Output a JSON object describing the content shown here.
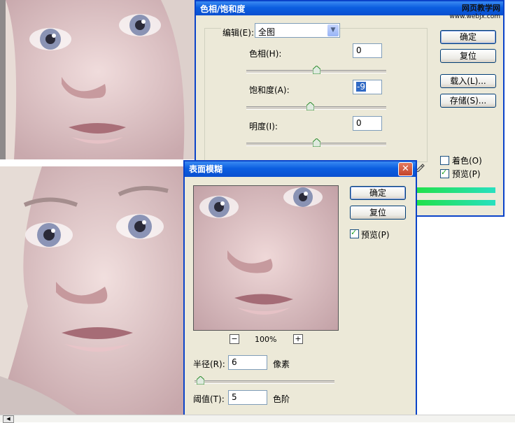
{
  "hue_sat_dialog": {
    "title": "色相/饱和度",
    "edit_label": "编辑(E):",
    "edit_value": "全图",
    "hue_label": "色相(H):",
    "hue_value": "0",
    "sat_label": "饱和度(A):",
    "sat_value": "-9",
    "light_label": "明度(I):",
    "light_value": "0",
    "ok": "确定",
    "reset": "复位",
    "load": "载入(L)...",
    "save": "存储(S)...",
    "colorize": "着色(O)",
    "preview": "预览(P)",
    "colorize_checked": false,
    "preview_checked": true,
    "hue_level": 0.5,
    "sat_level": 0.455,
    "light_level": 0.5
  },
  "watermark": {
    "line1": "网页教学网",
    "line2": "www.webjx.com"
  },
  "blur_dialog": {
    "title": "表面模糊",
    "ok": "确定",
    "reset": "复位",
    "preview": "预览(P)",
    "preview_checked": true,
    "zoom_out": "−",
    "zoom": "100%",
    "zoom_in": "+",
    "radius_label": "半径(R):",
    "radius_value": "6",
    "radius_unit": "像素",
    "threshold_label": "阈值(T):",
    "threshold_value": "5",
    "threshold_unit": "色阶",
    "radius_level": 0.04
  },
  "colors": {
    "title_bar": "#0a5ae0",
    "dialog_bg": "#ece9d8",
    "close_red": "#d4563a",
    "gradient_green": "#22e04a",
    "gradient_cyan": "#28e0c0"
  }
}
